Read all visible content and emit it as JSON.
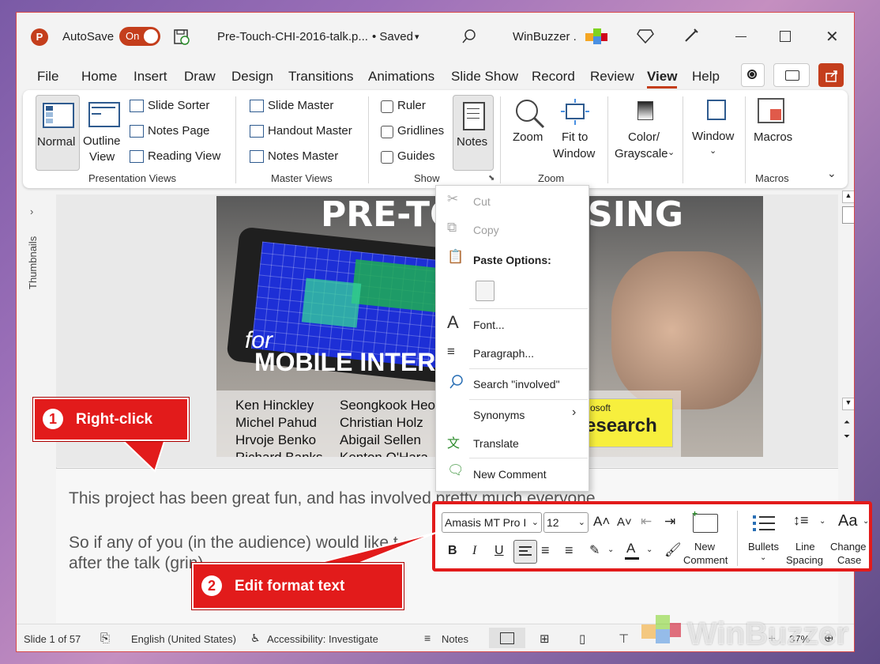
{
  "titlebar": {
    "app_icon": "P",
    "autosave_label": "AutoSave",
    "autosave_state": "On",
    "file_name": "Pre-Touch-CHI-2016-talk.p...",
    "save_status": "• Saved",
    "user_name": "WinBuzzer ."
  },
  "tabs": [
    "File",
    "Home",
    "Insert",
    "Draw",
    "Design",
    "Transitions",
    "Animations",
    "Slide Show",
    "Record",
    "Review",
    "View",
    "Help"
  ],
  "active_tab": "View",
  "ribbon": {
    "normal": "Normal",
    "outline_view_1": "Outline",
    "outline_view_2": "View",
    "slide_sorter": "Slide Sorter",
    "notes_page": "Notes Page",
    "reading_view": "Reading View",
    "group_presentation_views": "Presentation Views",
    "slide_master": "Slide Master",
    "handout_master": "Handout Master",
    "notes_master": "Notes Master",
    "group_master_views": "Master Views",
    "ruler": "Ruler",
    "gridlines": "Gridlines",
    "guides": "Guides",
    "notes": "Notes",
    "group_show": "Show",
    "zoom": "Zoom",
    "fit_to_window_1": "Fit to",
    "fit_to_window_2": "Window",
    "group_zoom": "Zoom",
    "color_grayscale_1": "Color/",
    "color_grayscale_2": "Grayscale",
    "window": "Window",
    "macros": "Macros",
    "group_macros": "Macros"
  },
  "left_pane": {
    "thumbnails": "Thumbnails"
  },
  "slide": {
    "title": "PRE-TO",
    "title_tail": "SING",
    "for_text": "for",
    "subtitle": "MOBILE INTERA",
    "authors_col1": [
      "Ken Hinckley",
      "Michel Pahud",
      "Hrvoje Benko",
      "Richard Banks"
    ],
    "authors_col2": [
      "Seongkook Heo",
      "Christian Holz",
      "Abigail Sellen",
      "Kenton O'Hara"
    ],
    "logo_small": "osoft",
    "logo_big": "esearch"
  },
  "notes": {
    "line1": "This project has been great fun, and has involved pretty much everyone. ...",
    "line2": "So if any of you (in the audience) would like t",
    "line3": "after the talk (grin)."
  },
  "context_menu": {
    "cut": "Cut",
    "copy": "Copy",
    "paste_options": "Paste Options:",
    "font": "Font...",
    "paragraph": "Paragraph...",
    "search": "Search \"involved\"",
    "synonyms": "Synonyms",
    "translate": "Translate",
    "new_comment": "New Comment"
  },
  "mini_toolbar": {
    "font_name": "Amasis MT Pro I",
    "font_size": "12",
    "bold": "B",
    "italic": "I",
    "underline": "U",
    "new_comment_1": "New",
    "new_comment_2": "Comment",
    "bullets": "Bullets",
    "line_spacing_1": "Line",
    "line_spacing_2": "Spacing",
    "change_case_1": "Change",
    "change_case_2": "Case",
    "change_case_icon": "Aa"
  },
  "callouts": {
    "c1_num": "1",
    "c1_text": "Right-click",
    "c2_num": "2",
    "c2_text": "Edit format text"
  },
  "status_bar": {
    "slide": "Slide 1 of 57",
    "language": "English (United States)",
    "accessibility": "Accessibility: Investigate",
    "notes": "Notes",
    "zoom": "37%"
  },
  "watermark": "WinBuzzer",
  "colors": {
    "accent": "#c43e1c",
    "callout": "#e21b1b"
  }
}
